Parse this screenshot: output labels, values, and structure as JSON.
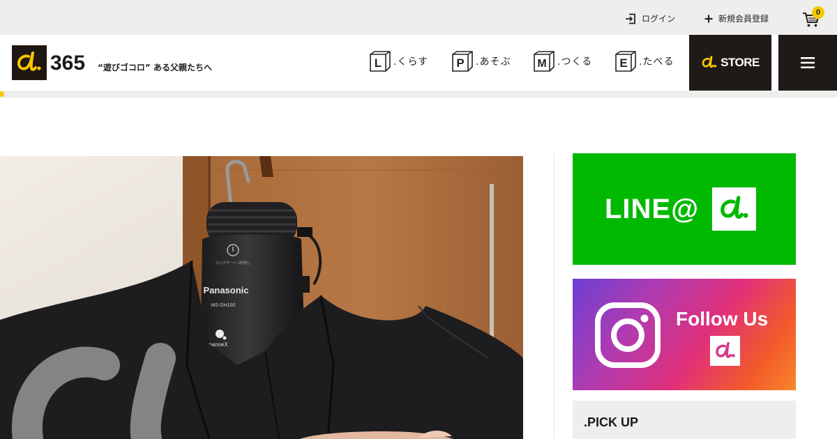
{
  "topbar": {
    "login_label": "ログイン",
    "register_label": "新規会員登録",
    "cart_count": "0"
  },
  "header": {
    "logo_mark": "d.",
    "logo_number": "365",
    "tagline": "“遊びゴコロ” ある父親たちへ",
    "nav": [
      {
        "letter": "L",
        "label": ".くらす"
      },
      {
        "letter": "P",
        "label": ".あそぶ"
      },
      {
        "letter": "M",
        "label": ".つくる"
      },
      {
        "letter": "E",
        "label": ".たべる"
      }
    ],
    "store_mark": "d.",
    "store_label": "STORE"
  },
  "sidebar": {
    "line_banner": {
      "text": "LINE@",
      "mark": "d."
    },
    "instagram_banner": {
      "text": "Follow Us",
      "mark": "d."
    },
    "pickup_title": ".PICK UP"
  },
  "hero": {
    "photo_brand": "Panasonic",
    "photo_model": "MS-DH100",
    "photo_tech": "nanoe X"
  },
  "colors": {
    "accent_yellow": "#f6c800",
    "dark_brown": "#1f1711",
    "line_green": "#00b900"
  }
}
